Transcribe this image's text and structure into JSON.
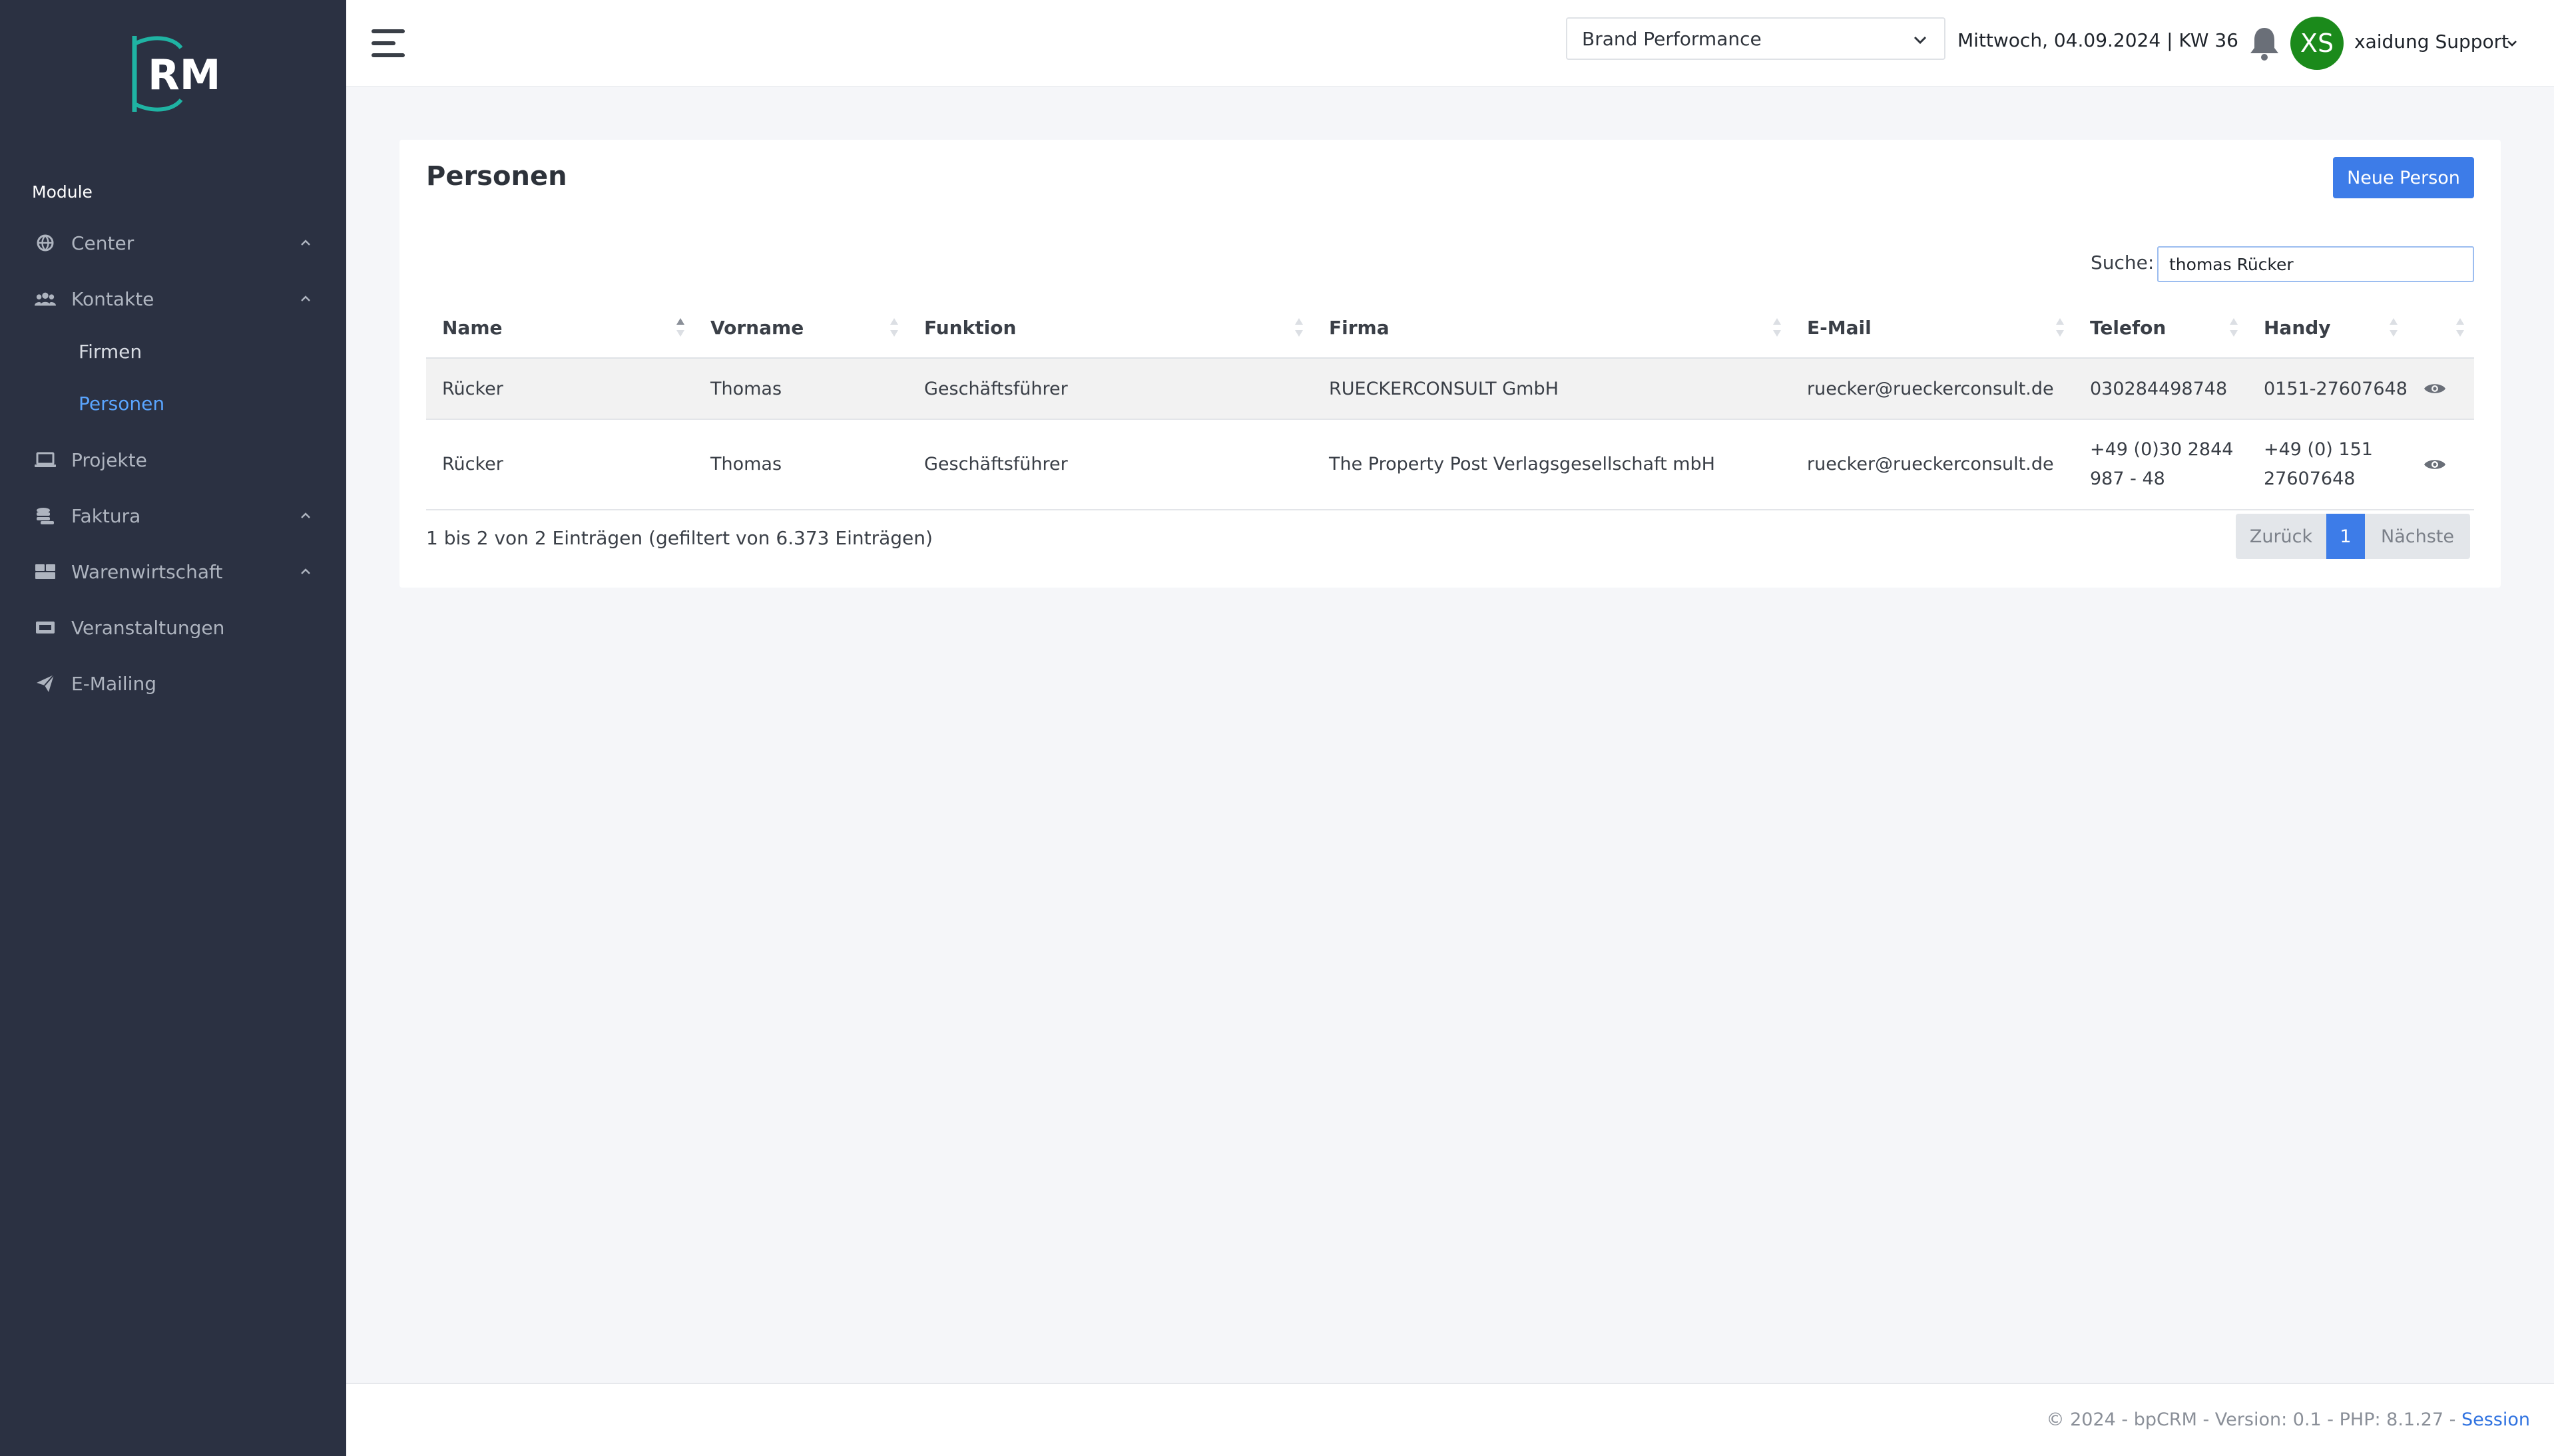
{
  "app": {
    "logo_text": "RM"
  },
  "sidebar": {
    "section_label": "Module",
    "items": [
      {
        "label": "Center",
        "icon": "globe-icon"
      },
      {
        "label": "Kontakte",
        "icon": "users-icon"
      },
      {
        "label": "Projekte",
        "icon": "laptop-icon"
      },
      {
        "label": "Faktura",
        "icon": "coins-icon"
      },
      {
        "label": "Warenwirtschaft",
        "icon": "boxes-icon"
      },
      {
        "label": "Veranstaltungen",
        "icon": "ticket-icon"
      },
      {
        "label": "E-Mailing",
        "icon": "paper-plane-icon"
      }
    ],
    "sub_items": [
      {
        "label": "Firmen"
      },
      {
        "label": "Personen",
        "active": true
      }
    ]
  },
  "topbar": {
    "brand_select": "Brand Performance",
    "date": "Mittwoch, 04.09.2024 | KW 36",
    "avatar_initials": "XS",
    "user_name": "xaidung Support"
  },
  "page": {
    "title": "Personen",
    "new_button": "Neue Person",
    "search_label": "Suche:",
    "search_value": "thomas Rücker"
  },
  "table": {
    "columns": [
      "Name",
      "Vorname",
      "Funktion",
      "Firma",
      "E-Mail",
      "Telefon",
      "Handy",
      ""
    ],
    "rows": [
      [
        "Rücker",
        "Thomas",
        "Geschäftsführer",
        "RUECKERCONSULT GmbH",
        "ruecker@rueckerconsult.de",
        "030284498748",
        "0151-27607648"
      ],
      [
        "Rücker",
        "Thomas",
        "Geschäftsführer",
        "The Property Post Verlagsgesellschaft mbH",
        "ruecker@rueckerconsult.de",
        "+49 (0)30 2844 987 - 48",
        "+49 (0) 151 27607648"
      ]
    ],
    "info": "1 bis 2 von 2 Einträgen (gefiltert von 6.373 Einträgen)",
    "pager": {
      "prev": "Zurück",
      "page": "1",
      "next": "Nächste"
    }
  },
  "footer": {
    "text": "© 2024 - bpCRM - Version: 0.1 - PHP: 8.1.27 - ",
    "link": "Session"
  },
  "colors": {
    "sidebar_bg": "#2b3142",
    "accent": "#3d7ce8",
    "active_nav": "#5aa5ff",
    "avatar_bg": "#1b8a1b"
  }
}
